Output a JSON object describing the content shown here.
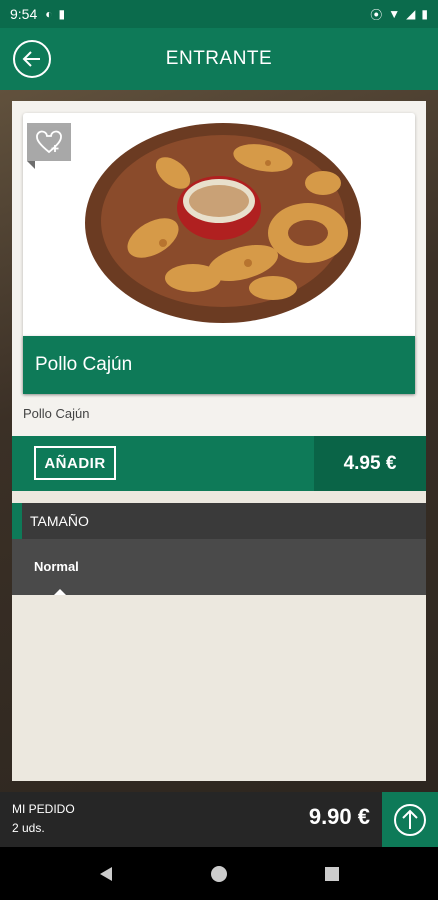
{
  "status_bar": {
    "time": "9:54"
  },
  "header": {
    "title": "ENTRANTE"
  },
  "product": {
    "name": "Pollo Cajún",
    "description": "Pollo Cajún",
    "add_label": "AÑADIR",
    "price": "4.95 €"
  },
  "options": {
    "section_title": "TAMAÑO",
    "selected": "Normal"
  },
  "order": {
    "label": "MI PEDIDO",
    "count": "2 uds.",
    "total": "9.90 €"
  },
  "colors": {
    "accent": "#0e7a58",
    "dark": "#3a3a3a"
  },
  "icons": [
    "back-arrow-icon",
    "favorite-add-icon",
    "arrow-up-icon",
    "nav-back-icon",
    "nav-home-icon",
    "nav-recents-icon"
  ]
}
